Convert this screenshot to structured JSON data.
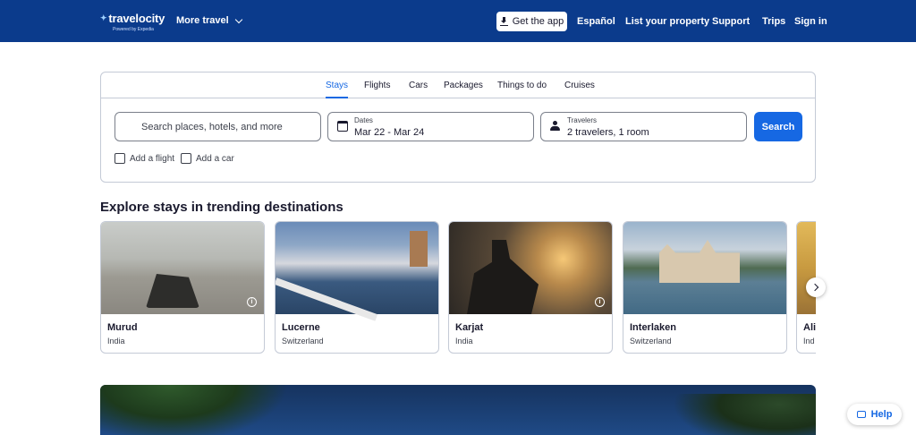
{
  "header": {
    "logo_text": "travelocity",
    "logo_powered": "Powered by Expedia",
    "more_travel": "More travel",
    "get_app": "Get the app",
    "links": [
      "Español",
      "List your property",
      "Support",
      "Trips",
      "Sign in"
    ],
    "brand_color": "#0b3b8c"
  },
  "search": {
    "tabs": [
      "Stays",
      "Flights",
      "Cars",
      "Packages",
      "Things to do",
      "Cruises"
    ],
    "active_tab": "Stays",
    "destination_placeholder": "Search places, hotels, and more",
    "dates_label": "Dates",
    "dates_value": "Mar 22 - Mar 24",
    "travelers_label": "Travelers",
    "travelers_value": "2 travelers, 1 room",
    "search_button": "Search",
    "add_flight": "Add a flight",
    "add_car": "Add a car",
    "accent_color": "#1668e3"
  },
  "trending": {
    "title": "Explore stays in trending destinations",
    "cards": [
      {
        "city": "Murud",
        "country": "India"
      },
      {
        "city": "Lucerne",
        "country": "Switzerland"
      },
      {
        "city": "Karjat",
        "country": "India"
      },
      {
        "city": "Interlaken",
        "country": "Switzerland"
      },
      {
        "city": "Ali",
        "country": "Ind"
      }
    ]
  },
  "help": {
    "label": "Help"
  }
}
